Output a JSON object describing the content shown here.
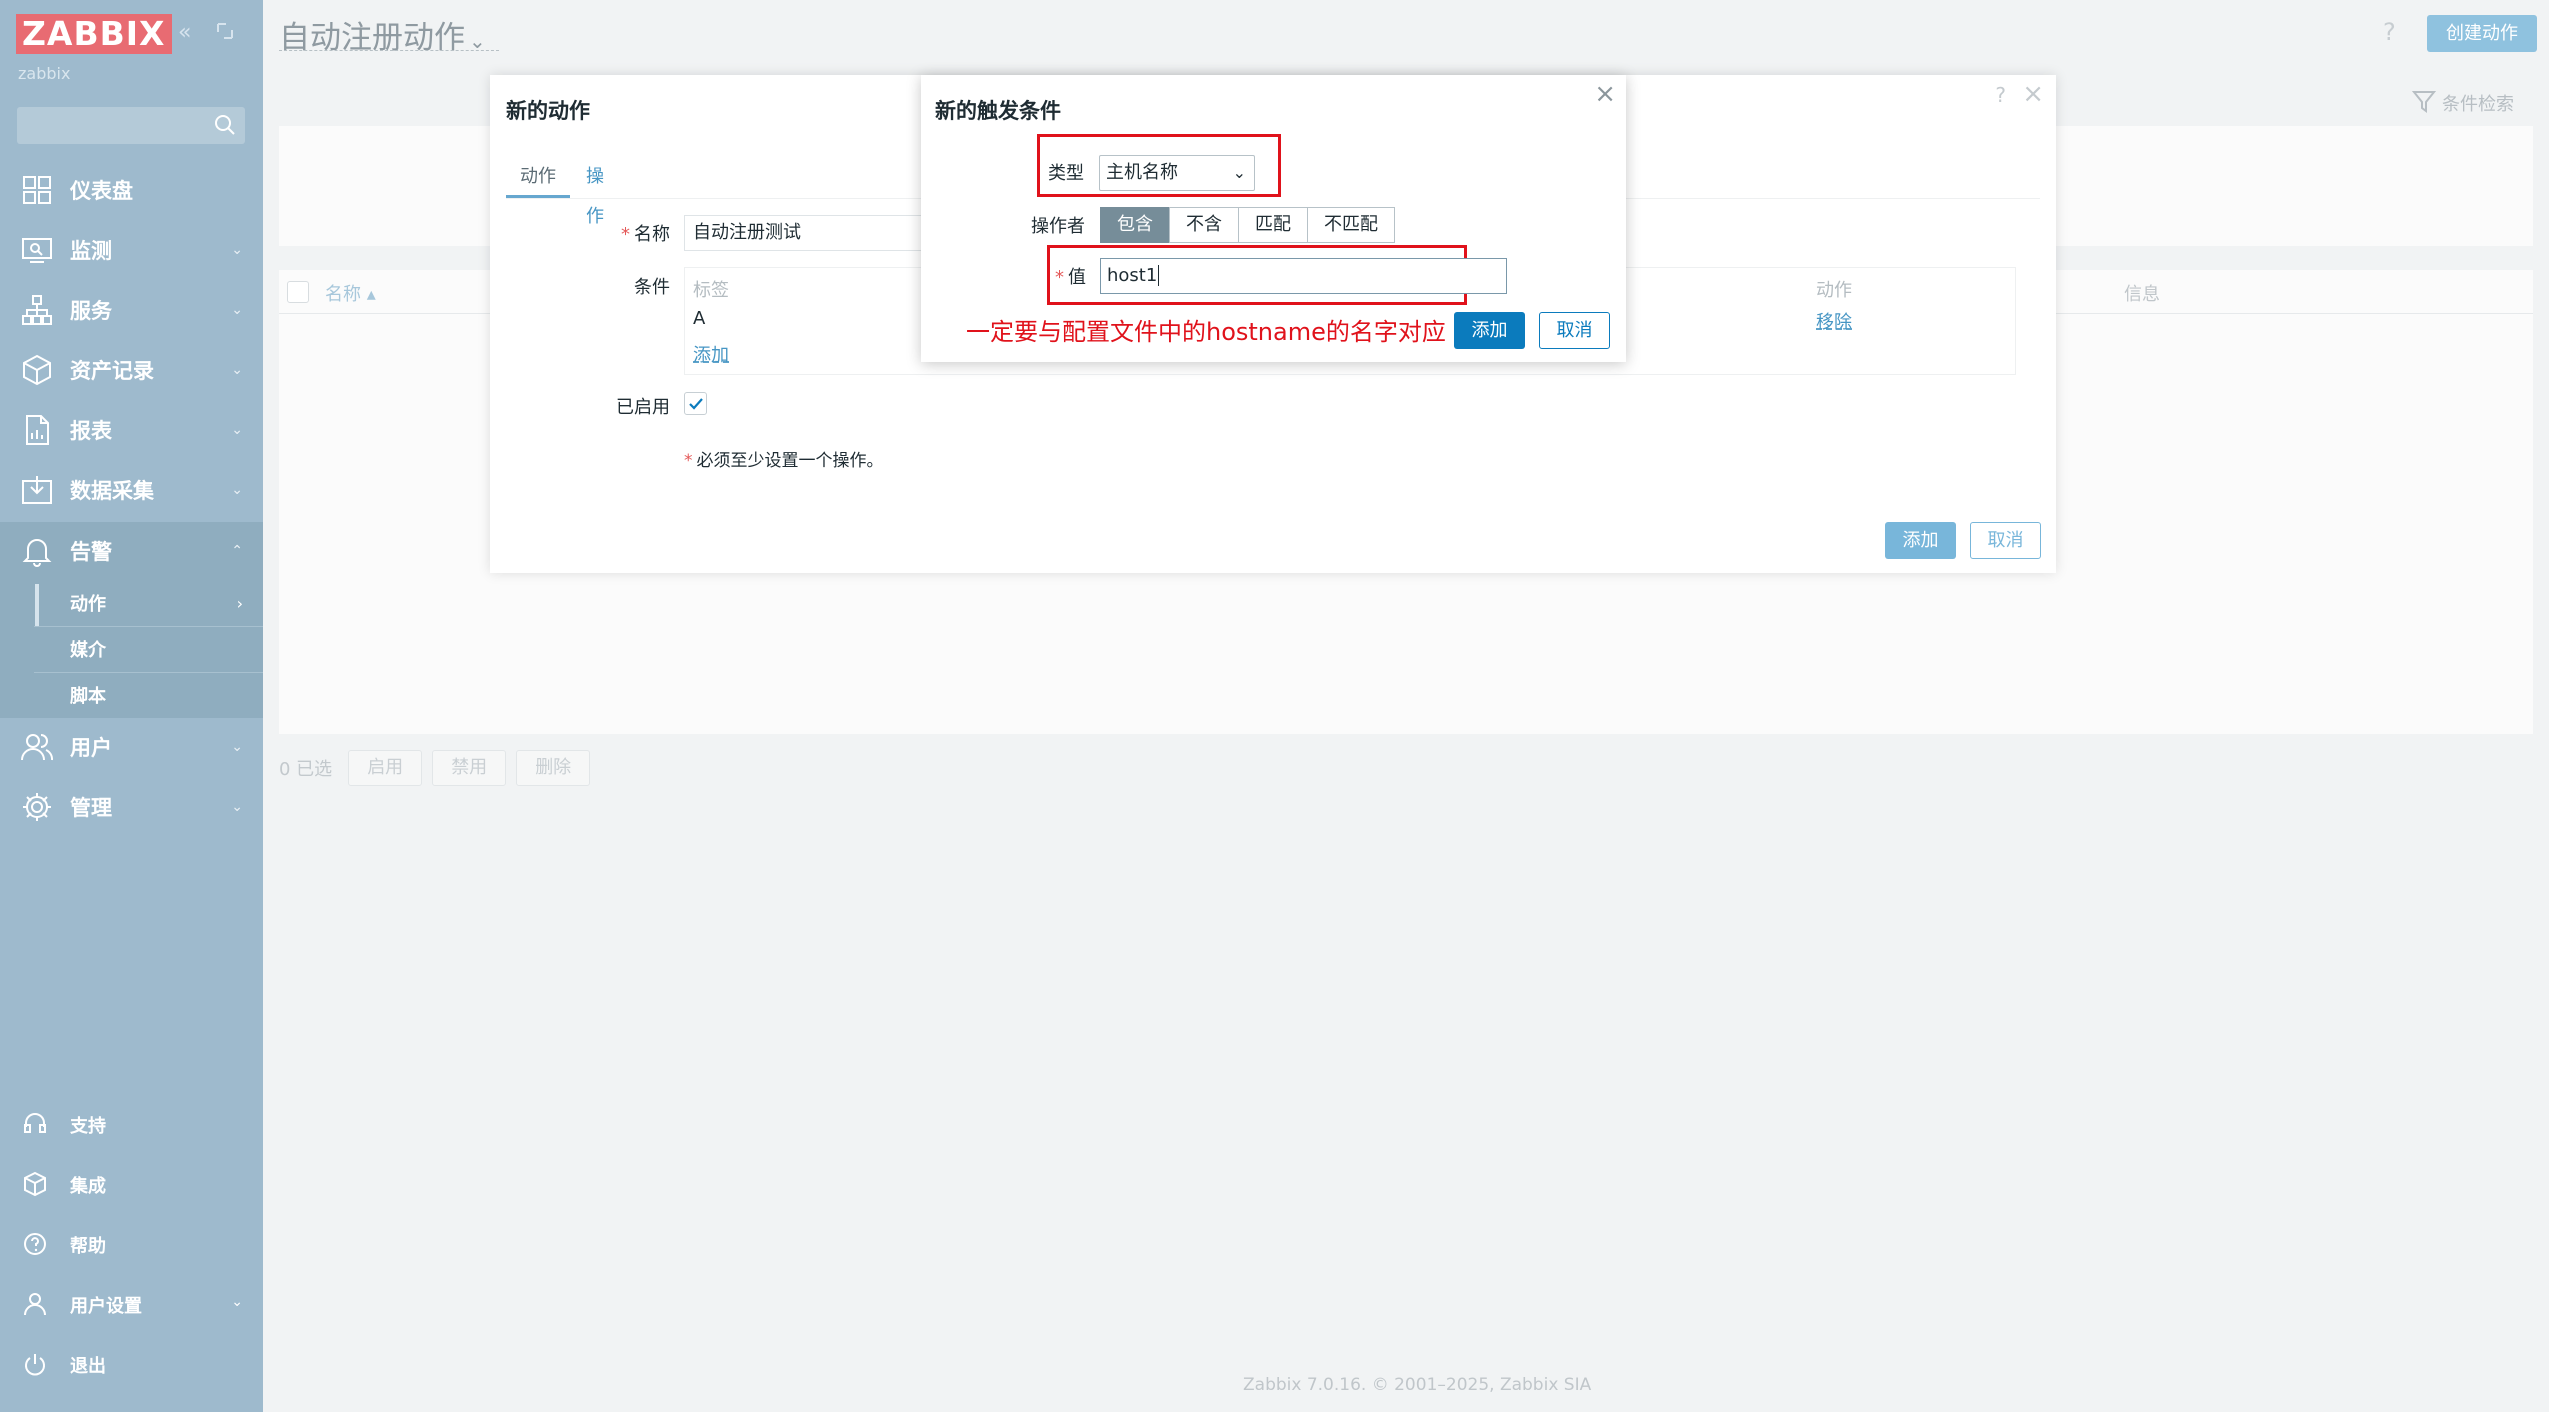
{
  "sidebar": {
    "logo": "ZABBIX",
    "server_name": "zabbix",
    "search_placeholder": "",
    "menu": [
      {
        "label": "仪表盘",
        "icon": "dashboard-icon"
      },
      {
        "label": "监测",
        "icon": "monitoring-icon"
      },
      {
        "label": "服务",
        "icon": "services-icon"
      },
      {
        "label": "资产记录",
        "icon": "inventory-icon"
      },
      {
        "label": "报表",
        "icon": "reports-icon"
      },
      {
        "label": "数据采集",
        "icon": "data-collection-icon"
      },
      {
        "label": "告警",
        "icon": "bell-icon"
      },
      {
        "label": "用户",
        "icon": "users-icon"
      },
      {
        "label": "管理",
        "icon": "gear-icon"
      }
    ],
    "submenu": [
      "动作",
      "媒介",
      "脚本"
    ],
    "bottom": [
      {
        "label": "支持",
        "icon": "headset-icon"
      },
      {
        "label": "集成",
        "icon": "integrations-icon"
      },
      {
        "label": "帮助",
        "icon": "help-icon"
      },
      {
        "label": "用户设置",
        "icon": "user-settings-icon"
      },
      {
        "label": "退出",
        "icon": "power-icon"
      }
    ]
  },
  "header": {
    "title": "自动注册动作",
    "help": "?",
    "create_button": "创建动作",
    "filter_tab": "条件检索"
  },
  "list": {
    "col_name": "名称 ▴",
    "col_info": "信息",
    "selected_count": "0 已选",
    "buttons": [
      "启用",
      "禁用",
      "删除"
    ]
  },
  "footer": {
    "copyright": "Zabbix 7.0.16. © 2001–2025, Zabbix SIA"
  },
  "dialog_action": {
    "title": "新的动作",
    "help": "?",
    "close": "×",
    "tabs": [
      "动作",
      "操作"
    ],
    "name_label": "名称",
    "name_value": "自动注册测试",
    "conditions_label": "条件",
    "cond_col_label": "标签",
    "cond_col_action": "动作",
    "cond_row_label": "A",
    "cond_row_remove": "移除",
    "cond_add": "添加",
    "enabled_label": "已启用",
    "enabled_mark": "✓",
    "note": "必须至少设置一个操作。",
    "add_button": "添加",
    "cancel_button": "取消"
  },
  "dialog_condition": {
    "title": "新的触发条件",
    "close": "×",
    "type_label": "类型",
    "type_value": "主机名称",
    "operator_label": "操作者",
    "operators": [
      "包含",
      "不含",
      "匹配",
      "不匹配"
    ],
    "operator_selected": "包含",
    "value_label": "值",
    "value": "host1",
    "add_button": "添加",
    "cancel_button": "取消",
    "annotation": "一定要与配置文件中的hostname的名字对应"
  },
  "colors": {
    "sidebar_bg": "#9ebacd",
    "primary": "#0b7bbd",
    "annotation_red": "#e0121b",
    "logo_bg": "#e86b72"
  }
}
